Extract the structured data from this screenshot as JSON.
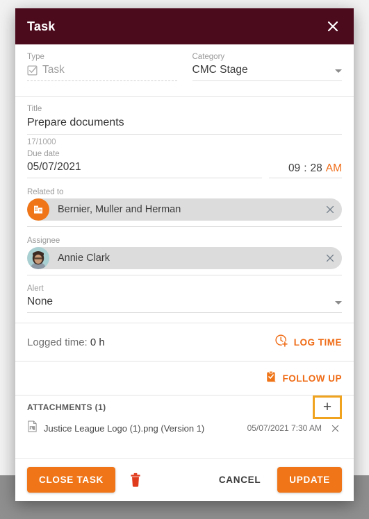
{
  "window": {
    "title": "Task",
    "close_icon": "close-icon"
  },
  "form": {
    "type": {
      "label": "Type",
      "value": "Task",
      "icon": "checkbox-checked-icon"
    },
    "category": {
      "label": "Category",
      "value": "CMC Stage",
      "caret_icon": "chevron-down-icon"
    },
    "title": {
      "label": "Title",
      "value": "Prepare documents",
      "counter": "17/1000"
    },
    "due_date": {
      "label": "Due date",
      "value": "05/07/2021",
      "hour": "09",
      "separator": ":",
      "minute": "28",
      "meridiem": "AM"
    },
    "related_to": {
      "label": "Related to",
      "value": "Bernier, Muller and Herman",
      "icon": "company-building-icon",
      "clear_icon": "close-icon"
    },
    "assignee": {
      "label": "Assignee",
      "value": "Annie Clark",
      "icon": "avatar-photo",
      "clear_icon": "close-icon"
    },
    "alert": {
      "label": "Alert",
      "value": "None",
      "caret_icon": "chevron-down-icon"
    }
  },
  "logged_time": {
    "label": "Logged time:",
    "value": "0 h",
    "log_time_button": "LOG TIME",
    "log_time_icon": "clock-plus-icon"
  },
  "follow_up": {
    "label": "FOLLOW UP",
    "icon": "clipboard-check-icon"
  },
  "attachments": {
    "heading": "ATTACHMENTS (1)",
    "add_button": "+",
    "add_button_icon": "plus-icon",
    "items": [
      {
        "name": "Justice League Logo (1).png (Version 1)",
        "date": "05/07/2021 7:30 AM",
        "file_icon": "image-file-icon",
        "remove_icon": "close-icon"
      }
    ]
  },
  "footer": {
    "close_task": "CLOSE TASK",
    "delete_icon": "trash-icon",
    "cancel": "CANCEL",
    "update": "UPDATE"
  },
  "annotation": {
    "arrow_icon": "arrow-right-annotation",
    "cursor_icon": "mouse-cursor-icon"
  },
  "colors": {
    "header": "#4c0a1d",
    "accent": "#ef7518",
    "highlight": "#f0a31e",
    "delete": "#e03b1c"
  }
}
